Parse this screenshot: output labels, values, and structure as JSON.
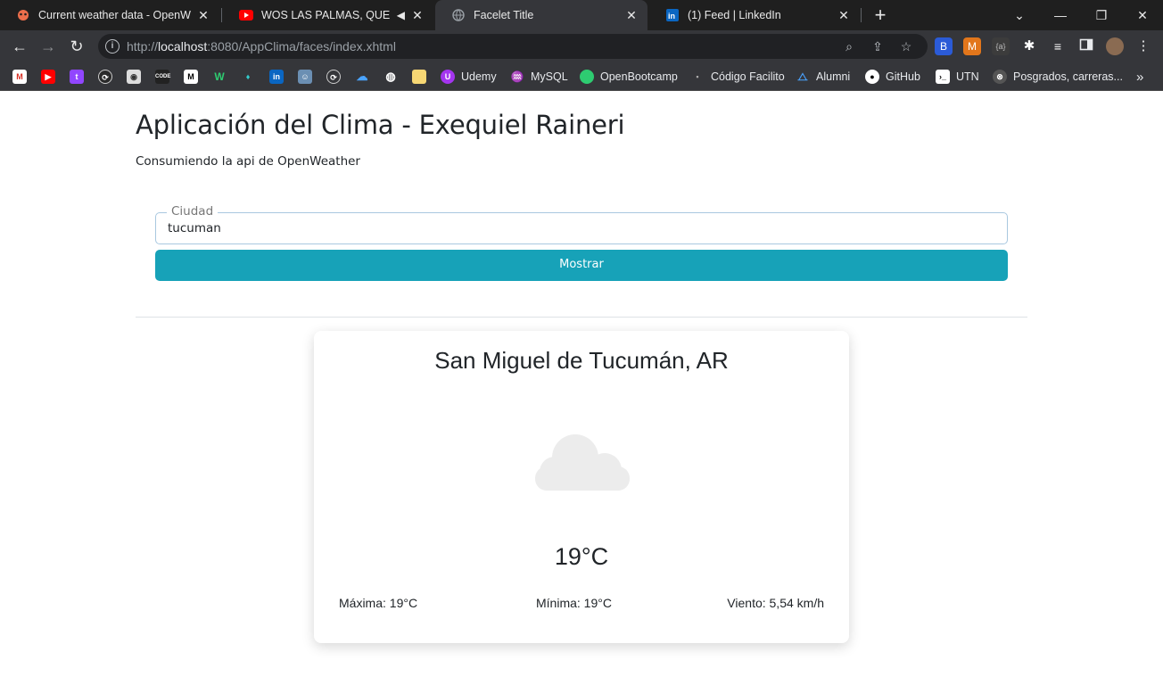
{
  "browser": {
    "tabs": [
      {
        "title": "Current weather data - OpenWea",
        "icon": "openweather-icon"
      },
      {
        "title": "WOS LAS PALMAS, QUEVEDO",
        "icon": "youtube-icon"
      },
      {
        "title": "Facelet Title",
        "icon": "globe-icon"
      },
      {
        "title": "(1) Feed | LinkedIn",
        "icon": "linkedin-icon"
      }
    ],
    "url_host": "localhost",
    "url_prefix": "http://",
    "url_rest": ":8080/AppClima/faces/index.xhtml",
    "bookmarks": [
      {
        "label": "Udemy"
      },
      {
        "label": "MySQL"
      },
      {
        "label": "OpenBootcamp"
      },
      {
        "label": "Código Facilito"
      },
      {
        "label": "Alumni"
      },
      {
        "label": "GitHub"
      },
      {
        "label": "UTN"
      },
      {
        "label": "Posgrados, carreras..."
      }
    ]
  },
  "page": {
    "title": "Aplicación del Clima - Exequiel Raineri",
    "subtitle": "Consumiendo la api de OpenWeather",
    "city_field": {
      "legend": "Ciudad",
      "value": "tucuman"
    },
    "submit_label": "Mostrar"
  },
  "weather": {
    "location": "San Miguel de Tucumán, AR",
    "icon": "cloud-icon",
    "temperature": "19°C",
    "max": "Máxima: 19°C",
    "min": "Mínima: 19°C",
    "wind": "Viento: 5,54 km/h"
  },
  "colors": {
    "accent_button": "#17a2b8",
    "tabbar": "#1f1f1f",
    "toolbar": "#35363a"
  }
}
